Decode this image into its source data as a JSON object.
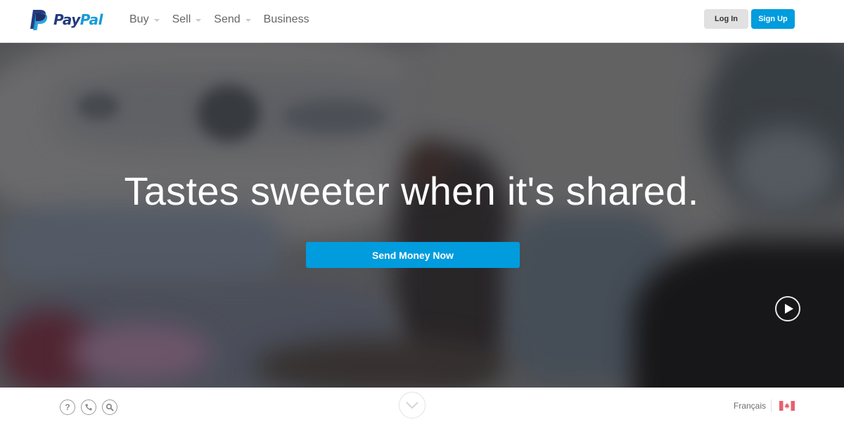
{
  "brand": {
    "name_part1": "Pay",
    "name_part2": "Pal",
    "colors": {
      "dark_blue": "#253b80",
      "light_blue": "#179bd7",
      "accent": "#009cde"
    }
  },
  "nav": {
    "items": [
      {
        "label": "Buy",
        "has_dropdown": true
      },
      {
        "label": "Sell",
        "has_dropdown": true
      },
      {
        "label": "Send",
        "has_dropdown": true
      },
      {
        "label": "Business",
        "has_dropdown": false
      }
    ]
  },
  "auth": {
    "login_label": "Log In",
    "signup_label": "Sign Up"
  },
  "hero": {
    "headline": "Tastes sweeter when it's shared.",
    "cta_label": "Send Money Now",
    "play_icon": "play-icon"
  },
  "footer": {
    "icons": [
      "help-icon",
      "phone-icon",
      "search-icon"
    ],
    "help_glyph": "?",
    "scroll_icon": "chevron-down-icon",
    "language_label": "Français",
    "country_flag": "canada-flag-icon"
  }
}
